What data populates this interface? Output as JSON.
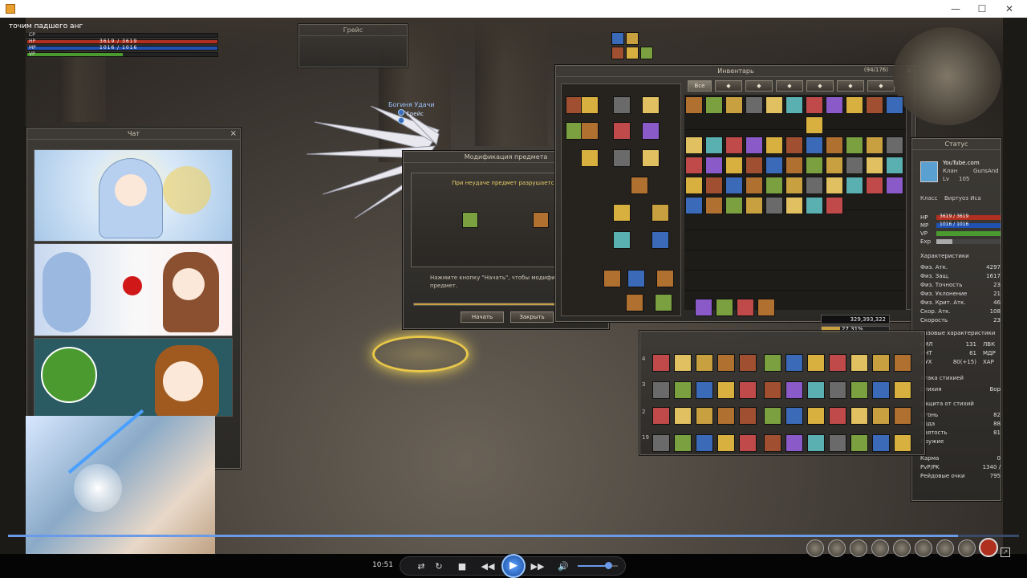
{
  "window": {
    "min_glyph": "—",
    "max_glyph": "☐",
    "close_glyph": "✕"
  },
  "overlay": {
    "title": "точим падшего анг"
  },
  "bars": [
    {
      "label": "CP",
      "value": "",
      "color": "#b8860b",
      "fill": 0
    },
    {
      "label": "HP",
      "value": "3619 / 3619",
      "color": "#b03020",
      "fill": 1
    },
    {
      "label": "MP",
      "value": "1016 / 1016",
      "color": "#2050b0",
      "fill": 1
    },
    {
      "label": "VP",
      "value": "",
      "color": "#4a9a30",
      "fill": 0.5
    }
  ],
  "target": {
    "name": "Грейс"
  },
  "npc": {
    "title": "Богиня Удачи",
    "name": "Грейс"
  },
  "chat": {
    "title": "Чат"
  },
  "modify": {
    "title": "Модификация предмета",
    "warning": "При неудаче предмет разрушается.",
    "hint": "Нажмите кнопку \"Начать\", чтобы модифицировать предмет.",
    "start": "Начать",
    "close": "Закрыть"
  },
  "inventory": {
    "title": "Инвентарь",
    "count": "(94/176)",
    "tab_all": "Все",
    "adena": "329,393,322",
    "weight": "27.31%"
  },
  "status": {
    "title": "Статус",
    "channel": "YouTube.com",
    "clan_label": "Клан",
    "clan": "GunsAnd",
    "lv_label": "Lv",
    "lv": "105",
    "class_label": "Класс",
    "class": "Виртуоз Иса",
    "hp": "3619 / 3619",
    "mp": "1016 / 1016",
    "vp_label": "VP",
    "exp_label": "Exp",
    "chars_head": "Характеристики",
    "stats": [
      {
        "label": "Физ. Атк.",
        "value": "4297"
      },
      {
        "label": "Физ. Защ.",
        "value": "1617"
      },
      {
        "label": "Физ. Точность",
        "value": "23"
      },
      {
        "label": "Физ. Уклонение",
        "value": "21"
      },
      {
        "label": "Физ. Крит. Атк.",
        "value": "46"
      },
      {
        "label": "Скор. Атк.",
        "value": "108"
      },
      {
        "label": "Скорость",
        "value": "23"
      }
    ],
    "base_head": "Базовые характеристики",
    "base": [
      {
        "l1": "СИЛ",
        "v1": "131",
        "l2": "ЛВК"
      },
      {
        "l1": "ИНТ",
        "v1": "61",
        "l2": "МДР"
      },
      {
        "l1": "ДУХ",
        "v1": "80(+15)",
        "l2": "ХАР"
      }
    ],
    "elem_atk_head": "Атака стихией",
    "elem_atk_label": "Стихия",
    "elem_atk_value": "Вор",
    "elem_def_head": "Защита от стихий",
    "elem_def": [
      {
        "label": "Огонь",
        "value": "82"
      },
      {
        "label": "Вода",
        "value": "88"
      },
      {
        "label": "Святость",
        "value": "81"
      },
      {
        "label": "Оружие",
        "value": ""
      }
    ],
    "misc": [
      {
        "label": "Карма",
        "value": "0"
      },
      {
        "label": "PvP/PK",
        "value": "1340 /"
      },
      {
        "label": "Рейдовые очки",
        "value": "795"
      }
    ]
  },
  "hotbar": {
    "row_numbers": [
      "4",
      "3",
      "2",
      "19"
    ]
  },
  "player": {
    "time": "10:51",
    "progress": 0.94,
    "volume": 0.7,
    "icons": [
      "repeat-icon",
      "refresh-icon",
      "stop-icon",
      "rewind-icon",
      "play-icon",
      "fast-forward-icon",
      "volume-icon"
    ]
  }
}
